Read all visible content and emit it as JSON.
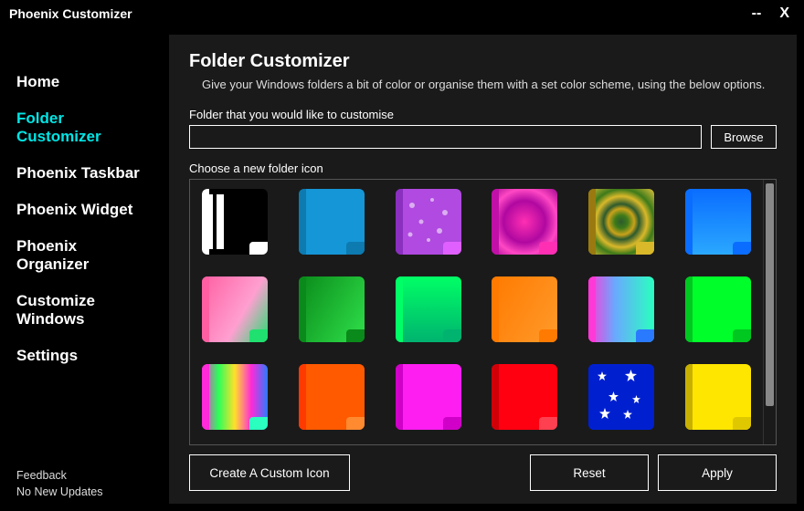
{
  "app": {
    "title": "Phoenix Customizer"
  },
  "window": {
    "minimize": "--",
    "close": "X"
  },
  "sidebar": {
    "items": [
      {
        "label": "Home"
      },
      {
        "label": "Folder Customizer",
        "active": true
      },
      {
        "label": "Phoenix Taskbar"
      },
      {
        "label": "Phoenix Widget"
      },
      {
        "label": "Phoenix Organizer"
      },
      {
        "label": "Customize Windows"
      },
      {
        "label": "Settings"
      }
    ],
    "footer": {
      "feedback": "Feedback",
      "updates": "No New Updates"
    }
  },
  "page": {
    "title": "Folder Customizer",
    "description": "Give your Windows folders a bit of color or organise them with a set color scheme, using the below options.",
    "path_label": "Folder that you would like to customise",
    "path_value": "",
    "browse": "Browse",
    "icon_label": "Choose a new folder icon",
    "icons": [
      {
        "name": "black-white",
        "class": "bg-blackwhite",
        "tab": "#ffffff",
        "spine": "#ffffff"
      },
      {
        "name": "blue",
        "class": "bg-blue1",
        "tab": "#0d7ab0",
        "spine": "#0d7ab0"
      },
      {
        "name": "purple-dots",
        "class": "bg-purpledots",
        "tab": "#e060ff",
        "spine": "#8a2fbf"
      },
      {
        "name": "magenta-swirl",
        "class": "bg-magentaswirl",
        "tab": "#ff2fb3",
        "spine": "#c010a8"
      },
      {
        "name": "gold-rings",
        "class": "bg-goldrings",
        "tab": "#d9b82a",
        "spine": "#9a7a10"
      },
      {
        "name": "blue-gradient",
        "class": "bg-blue2",
        "tab": "#0a6dff",
        "spine": "#0a6dff"
      },
      {
        "name": "pink-green",
        "class": "bg-pinkgreen",
        "tab": "#20e06f",
        "spine": "#ff5fa2"
      },
      {
        "name": "deep-green",
        "class": "bg-green1",
        "tab": "#0a8a1a",
        "spine": "#0a8a1a"
      },
      {
        "name": "bright-green",
        "class": "bg-greenteal",
        "tab": "#00b36f",
        "spine": "#00ff66"
      },
      {
        "name": "orange-grad",
        "class": "bg-orange1",
        "tab": "#ff7a00",
        "spine": "#ff7a00"
      },
      {
        "name": "rainbow",
        "class": "bg-rainbow1",
        "tab": "#2a7aff",
        "spine": "#ff39d8"
      },
      {
        "name": "neon-green",
        "class": "bg-greensolid",
        "tab": "#00c820",
        "spine": "#00c820"
      },
      {
        "name": "rainbow-bars",
        "class": "bg-rainbow2",
        "tab": "#2affc0",
        "spine": "#ff2ad8"
      },
      {
        "name": "orange",
        "class": "bg-orange2",
        "tab": "#ff8a30",
        "spine": "#ff3a00"
      },
      {
        "name": "magenta",
        "class": "bg-magenta",
        "tab": "#d000c8",
        "spine": "#d000c8"
      },
      {
        "name": "red",
        "class": "bg-red",
        "tab": "#ff4050",
        "spine": "#d00008"
      },
      {
        "name": "blue-stars",
        "class": "bg-stars",
        "tab": "#0020d0",
        "spine": "#0020d0"
      },
      {
        "name": "yellow",
        "class": "bg-yellow",
        "tab": "#e0c800",
        "spine": "#c8b000"
      }
    ],
    "actions": {
      "custom": "Create A Custom Icon",
      "reset": "Reset",
      "apply": "Apply"
    }
  }
}
